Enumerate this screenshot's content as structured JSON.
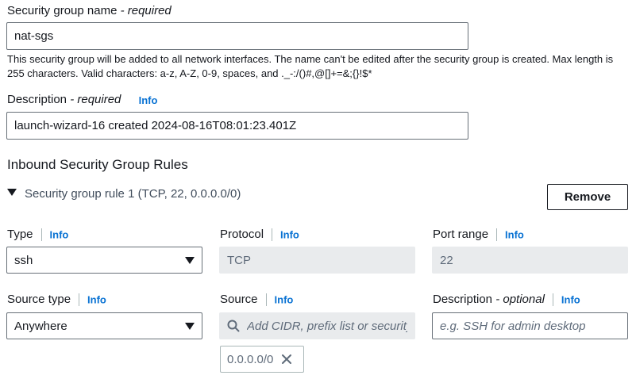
{
  "name_field": {
    "label": "Security group name",
    "suffix": "- required",
    "value": "nat-sgs",
    "help_line1": "This security group will be added to all network interfaces. The name can't be edited after the security group is created. Max length is",
    "help_line2": "255 characters. Valid characters: a-z, A-Z, 0-9, spaces, and ._-:/()#,@[]+=&;{}!$*"
  },
  "description_field": {
    "label": "Description",
    "suffix": "- required",
    "info": "Info",
    "value": "launch-wizard-16 created 2024-08-16T08:01:23.401Z"
  },
  "inbound": {
    "heading": "Inbound Security Group Rules",
    "rule_title": "Security group rule 1 (TCP, 22, 0.0.0.0/0)",
    "remove_label": "Remove",
    "type": {
      "label": "Type",
      "info": "Info",
      "value": "ssh"
    },
    "protocol": {
      "label": "Protocol",
      "info": "Info",
      "value": "TCP"
    },
    "port_range": {
      "label": "Port range",
      "info": "Info",
      "value": "22"
    },
    "source_type": {
      "label": "Source type",
      "info": "Info",
      "value": "Anywhere"
    },
    "source": {
      "label": "Source",
      "info": "Info",
      "placeholder": "Add CIDR, prefix list or security",
      "token": "0.0.0.0/0"
    },
    "rule_description": {
      "label": "Description",
      "suffix": "- optional",
      "info": "Info",
      "placeholder": "e.g. SSH for admin desktop"
    }
  },
  "colors": {
    "link": "#0972d3",
    "border": "#687078",
    "disabled_bg": "#e9ebed"
  }
}
